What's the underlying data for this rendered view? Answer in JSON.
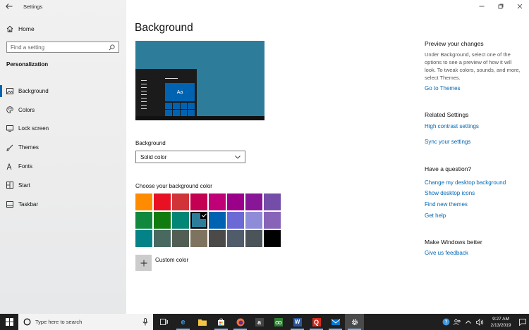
{
  "window": {
    "title": "Settings"
  },
  "sidebar": {
    "home_label": "Home",
    "search_placeholder": "Find a setting",
    "section_title": "Personalization",
    "items": [
      {
        "label": "Background",
        "icon": "image-icon",
        "active": true
      },
      {
        "label": "Colors",
        "icon": "palette-icon",
        "active": false
      },
      {
        "label": "Lock screen",
        "icon": "lock-screen-icon",
        "active": false
      },
      {
        "label": "Themes",
        "icon": "brush-icon",
        "active": false
      },
      {
        "label": "Fonts",
        "icon": "font-icon",
        "active": false
      },
      {
        "label": "Start",
        "icon": "start-icon",
        "active": false
      },
      {
        "label": "Taskbar",
        "icon": "taskbar-icon",
        "active": false
      }
    ]
  },
  "main": {
    "title": "Background",
    "preview_tile_label": "Aa",
    "background_label": "Background",
    "background_value": "Solid color",
    "choose_label": "Choose your background color",
    "custom_color_label": "Custom color",
    "selected_color_index": 11,
    "colors": [
      "#ff8c00",
      "#e81123",
      "#d13438",
      "#c30052",
      "#bf0077",
      "#9a0089",
      "#881798",
      "#744da9",
      "#10893e",
      "#107c10",
      "#018574",
      "#2d7d9a",
      "#0063b1",
      "#6b69d6",
      "#8e8cd8",
      "#8764b8",
      "#038387",
      "#486860",
      "#525e54",
      "#7e735f",
      "#4c4a48",
      "#515c6b",
      "#4a5459",
      "#000000"
    ]
  },
  "right_panel": {
    "preview_heading": "Preview your changes",
    "preview_text": "Under Background, select one of the options to see a preview of how it will look. To tweak colors, sounds, and more, select Themes.",
    "go_to_themes": "Go to Themes",
    "related_heading": "Related Settings",
    "related_links": [
      "High contrast settings",
      "Sync your settings"
    ],
    "question_heading": "Have a question?",
    "question_links": [
      "Change my desktop background",
      "Show desktop icons",
      "Find new themes",
      "Get help"
    ],
    "better_heading": "Make Windows better",
    "feedback_link": "Give us feedback"
  },
  "taskbar": {
    "search_placeholder": "Type here to search",
    "time": "9:27 AM",
    "date": "2/13/2019",
    "apps": [
      {
        "name": "task-view-icon",
        "color": "#ffffff"
      },
      {
        "name": "edge-icon",
        "color": "#3a96dd"
      },
      {
        "name": "file-explorer-icon",
        "color": "#f6c343"
      },
      {
        "name": "store-icon",
        "color": "#ffffff"
      },
      {
        "name": "firefox-icon",
        "color": "#ff7139"
      },
      {
        "name": "amazon-icon",
        "color": "#ffffff"
      },
      {
        "name": "tripadvisor-icon",
        "color": "#34e0a1"
      },
      {
        "name": "word-icon",
        "color": "#2b579a"
      },
      {
        "name": "quicken-icon",
        "color": "#d52b1e"
      },
      {
        "name": "mail-icon",
        "color": "#0078d4"
      },
      {
        "name": "settings-icon",
        "color": "#ffffff"
      }
    ]
  }
}
